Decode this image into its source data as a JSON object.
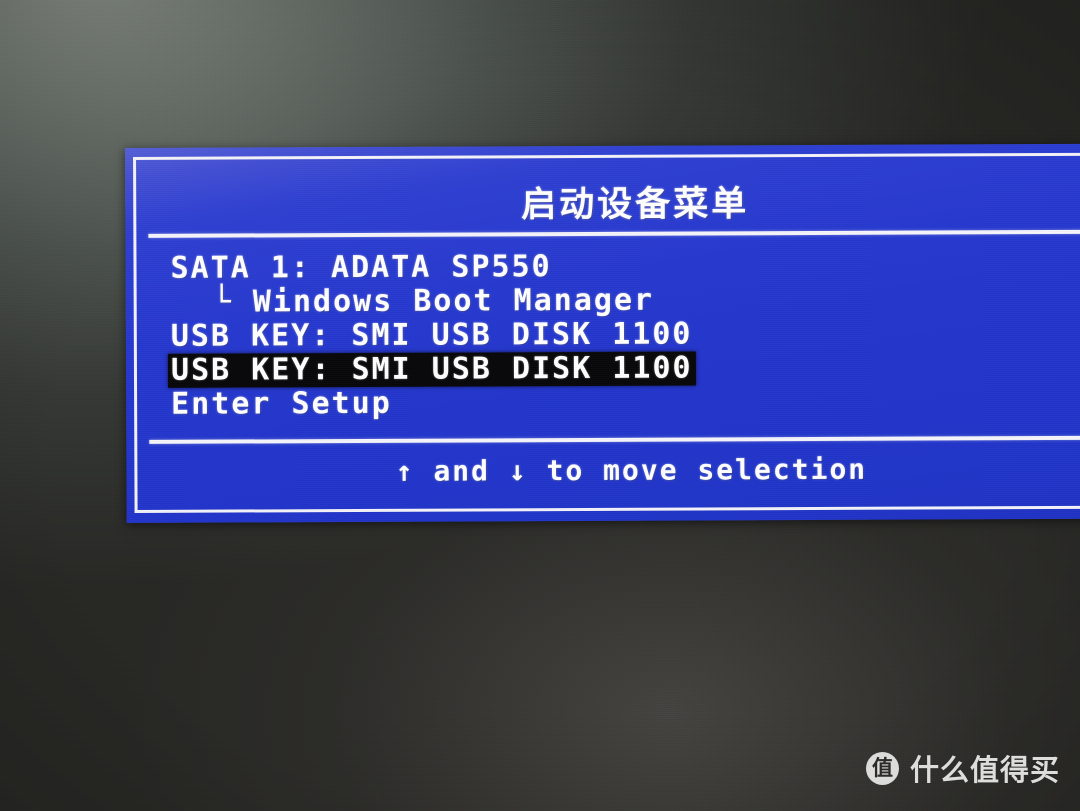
{
  "screen": {
    "kind": "bios-boot-device-menu",
    "panel_color": "#2739cf",
    "border_color": "#f2f2f8",
    "text_color": "#ffffff",
    "highlight_bg": "#08080a",
    "background_color": "#2b2a27"
  },
  "panel": {
    "title": "启动设备菜单"
  },
  "menu": {
    "items": [
      {
        "label": "SATA 1: ADATA SP550",
        "indented": false,
        "selected": false
      },
      {
        "label": "└ Windows Boot Manager",
        "indented": true,
        "selected": false
      },
      {
        "label": "USB KEY: SMI USB DISK 1100",
        "indented": false,
        "selected": false
      },
      {
        "label": "USB KEY: SMI USB DISK 1100",
        "indented": false,
        "selected": true
      },
      {
        "label": "Enter Setup",
        "indented": false,
        "selected": false
      }
    ]
  },
  "footer": {
    "hint": "↑ and ↓ to move selection"
  },
  "watermark": {
    "badge": "值",
    "text": "什么值得买"
  }
}
